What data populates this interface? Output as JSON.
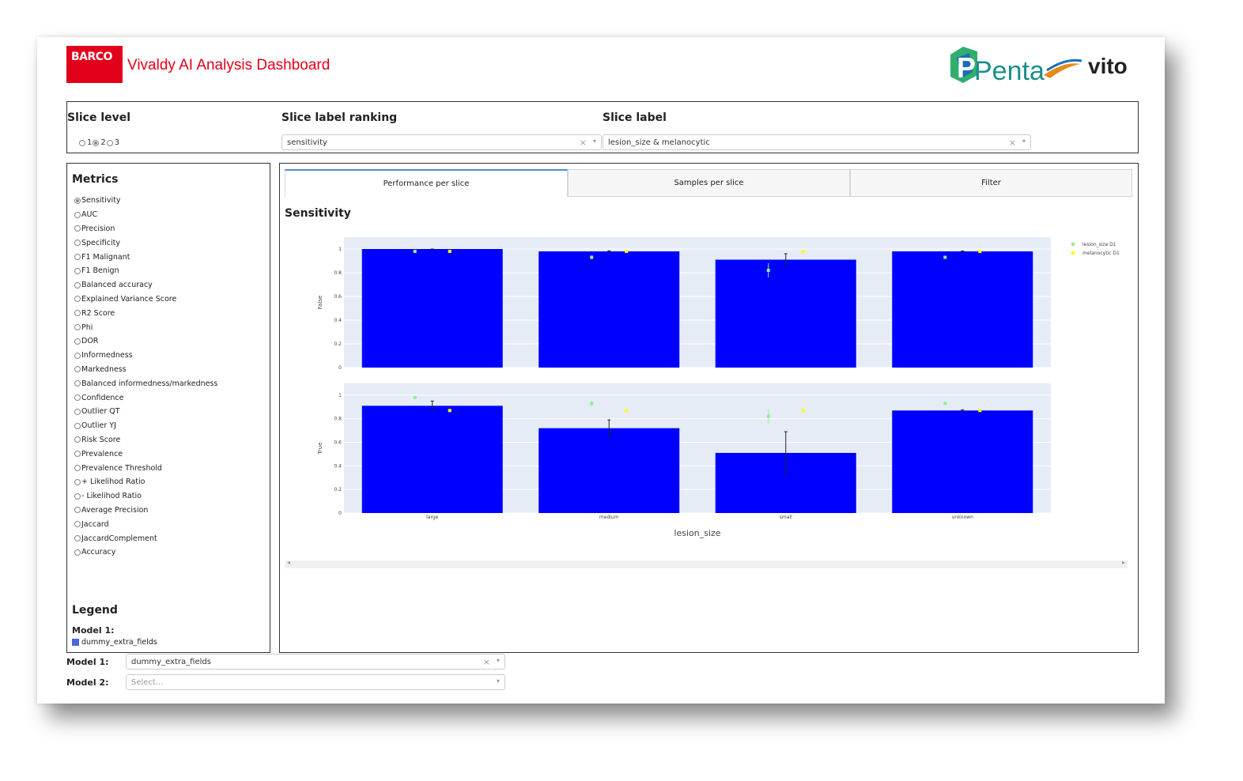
{
  "header": {
    "barco_logo": "BARCO",
    "title": "Vivaldy AI Analysis Dashboard",
    "partner_logo_left": "Penta",
    "partner_logo_right": "vito"
  },
  "controls": {
    "slice_level": {
      "label": "Slice level",
      "options": [
        "1",
        "2",
        "3"
      ],
      "selected": "2"
    },
    "slice_label_ranking": {
      "label": "Slice label ranking",
      "value": "sensitivity"
    },
    "slice_label": {
      "label": "Slice label",
      "value": "lesion_size & melanocytic"
    }
  },
  "metrics": {
    "heading": "Metrics",
    "selected": "Sensitivity",
    "items": [
      "Sensitivity",
      "AUC",
      "Precision",
      "Specificity",
      "F1 Malignant",
      "F1 Benign",
      "Balanced accuracy",
      "Explained Variance Score",
      "R2 Score",
      "Phi",
      "DOR",
      "Informedness",
      "Markedness",
      "Balanced informedness/markedness",
      "Confidence",
      "Outlier QT",
      "Outlier YJ",
      "Risk Score",
      "Prevalence",
      "Prevalence Threshold",
      "+ Likelihod Ratio",
      "- Likelihod Ratio",
      "Average Precision",
      "Jaccard",
      "JaccardComplement",
      "Accuracy"
    ]
  },
  "legend": {
    "heading": "Legend",
    "model_label": "Model 1:",
    "item": "dummy_extra_fields",
    "color": "#4a63e0"
  },
  "tabs": [
    "Performance per slice",
    "Samples per slice",
    "Filter"
  ],
  "active_tab": "Performance per slice",
  "model_select": {
    "model1": {
      "label": "Model 1:",
      "value": "dummy_extra_fields"
    },
    "model2": {
      "label": "Model 2:",
      "placeholder": "Select..."
    }
  },
  "chart_data": {
    "type": "bar",
    "title": "Sensitivity",
    "xlabel": "lesion_size",
    "categories": [
      "large",
      "medium",
      "small",
      "unknown"
    ],
    "bar_color": "#0000ff",
    "legend": [
      {
        "name": "lesion_size D1",
        "color": "#90ee90"
      },
      {
        "name": "melanocytic D1",
        "color": "#ffff00"
      }
    ],
    "ylim": [
      0,
      1.1
    ],
    "yticks": [
      "0",
      "0.2",
      "0.4",
      "0.6",
      "0.8",
      "1"
    ],
    "panels": [
      {
        "ylabel": "False",
        "values": [
          1.0,
          0.98,
          0.91,
          0.98
        ],
        "error_bars": [
          [
            0.998,
            1.0
          ],
          [
            0.978,
            0.985
          ],
          [
            0.87,
            0.96
          ],
          [
            0.977,
            0.983
          ]
        ],
        "lesion_size_points": [
          0.98,
          0.93,
          0.82,
          0.93
        ],
        "lesion_size_error": [
          [
            0.975,
            0.985
          ],
          [
            0.915,
            0.945
          ],
          [
            0.76,
            0.88
          ],
          [
            0.925,
            0.935
          ]
        ],
        "melanocytic_points": [
          0.98,
          0.98,
          0.98,
          0.98
        ]
      },
      {
        "ylabel": "True",
        "values": [
          0.91,
          0.72,
          0.51,
          0.87
        ],
        "error_bars": [
          [
            0.87,
            0.95
          ],
          [
            0.65,
            0.79
          ],
          [
            0.34,
            0.69
          ],
          [
            0.866,
            0.876
          ]
        ],
        "lesion_size_points": [
          0.98,
          0.93,
          0.82,
          0.93
        ],
        "lesion_size_error": [
          [
            0.975,
            0.985
          ],
          [
            0.91,
            0.95
          ],
          [
            0.76,
            0.88
          ],
          [
            0.925,
            0.935
          ]
        ],
        "melanocytic_points": [
          0.87,
          0.87,
          0.87,
          0.87
        ]
      }
    ]
  }
}
